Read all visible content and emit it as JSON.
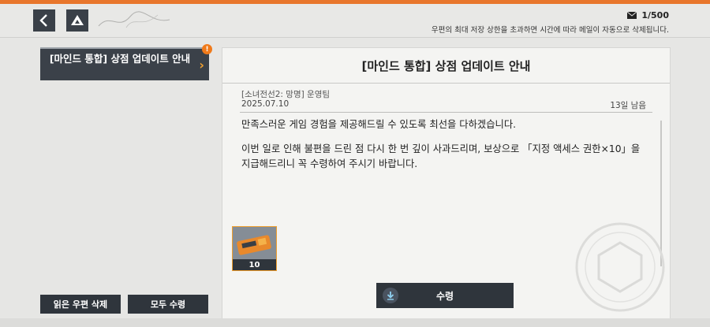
{
  "header": {
    "mail_count": "1/500",
    "notice": "우편의 최대 저장 상한을 초과하면 시간에 따라 메일이 자동으로 삭제됩니다."
  },
  "sidebar": {
    "items": [
      {
        "label": "[마인드 통합] 상점 업데이트 안내",
        "alert": "!"
      }
    ],
    "delete_read_label": "읽은 우편 삭제",
    "claim_all_label": "모두 수령"
  },
  "mail": {
    "title": "[마인드 통합] 상점 업데이트 안내",
    "sender": "[소녀전선2: 망명] 운영팀",
    "date": "2025.07.10",
    "days_left": "13일 남음",
    "body": [
      "만족스러운 게임 경험을 제공해드릴 수 있도록 최선을 다하겠습니다.",
      "이번 일로 인해 불편을 드린 점 다시 한 번 깊이 사과드리며, 보상으로 「지정 액세스 권한×10」을 지급해드리니 꼭 수령하여 주시기 바랍니다."
    ],
    "attachment": {
      "icon": "access-ticket-icon",
      "quantity": "10"
    },
    "claim_label": "수령"
  },
  "colors": {
    "accent": "#e8762c",
    "dark_button": "#2f353c",
    "item_border": "#f0a030"
  }
}
